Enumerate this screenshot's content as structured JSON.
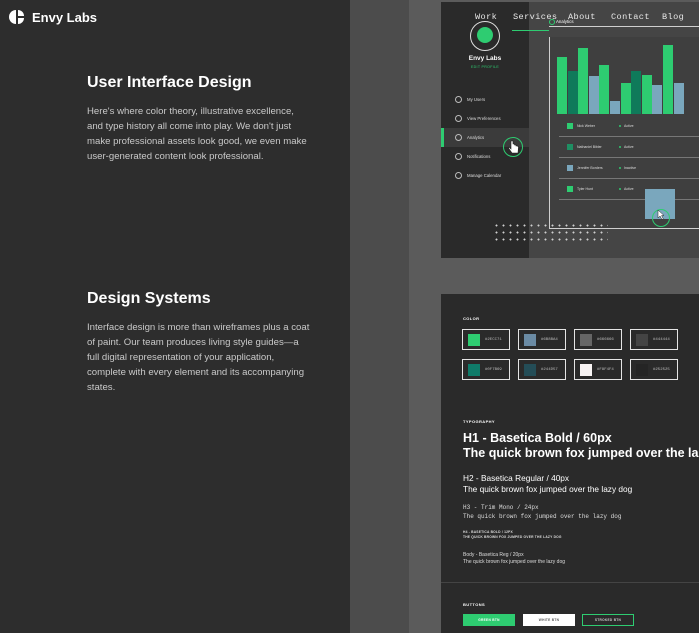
{
  "brand": {
    "name": "Envy Labs",
    "logo_icon": "envy-labs-logo-icon"
  },
  "sections": [
    {
      "title": "User Interface Design",
      "body": "Here's where color theory, illustrative excellence, and type history all come into play. We don't just make professional assets look good, we even make user-generated content look professional."
    },
    {
      "title": "Design Systems",
      "body": "Interface design is more than wireframes plus a coat of paint. Our team produces living style guides—a full digital representation of your application, complete with every element and its accompanying states."
    }
  ],
  "nav": {
    "items": [
      "Work",
      "Services",
      "About",
      "Contact",
      "Blog"
    ],
    "active": "Services"
  },
  "dashboard": {
    "user_name": "Envy Labs",
    "edit_link": "EDIT PROFILE",
    "menu": [
      {
        "label": "My Users",
        "icon": "user-icon"
      },
      {
        "label": "View Preferences",
        "icon": "eye-icon"
      },
      {
        "label": "Analytics",
        "icon": "chart-icon",
        "active": true
      },
      {
        "label": "Notifications",
        "icon": "bell-icon"
      },
      {
        "label": "Manage Calendar",
        "icon": "calendar-icon"
      }
    ],
    "analytics_title": "Analytics",
    "bar_values": [
      0.82,
      0.62,
      0.94,
      0.55,
      0.7,
      0.18,
      0.44,
      0.62,
      0.56,
      0.42,
      0.98,
      0.45
    ],
    "bar_colors": [
      "#0f7a5a",
      "#2ecc71",
      "#7aa7bd"
    ],
    "rows": [
      {
        "name": "Nick Weber",
        "status": "Active",
        "color": "#2ecc71"
      },
      {
        "name": "Nathaniel Bibler",
        "status": "Active",
        "color": "#1f8f63"
      },
      {
        "name": "Jennifer Borders",
        "status": "Inactive",
        "color": "#7aa7bd"
      },
      {
        "name": "Tyler Hunt",
        "status": "Active",
        "color": "#2ecc71"
      }
    ]
  },
  "design_system": {
    "color_label": "COLOR",
    "colors": [
      {
        "hex": "#2ECC71",
        "swatch": "#2ecc71"
      },
      {
        "hex": "#6B8BA4",
        "swatch": "#6b8ba4"
      },
      {
        "hex": "#666666",
        "swatch": "#666666"
      },
      {
        "hex": "#444444",
        "swatch": "#444444"
      },
      {
        "hex": "#0F7B69",
        "swatch": "#0f7b69"
      },
      {
        "hex": "#244D57",
        "swatch": "#244d57"
      },
      {
        "hex": "#F8F4F4",
        "swatch": "#f8f4f4"
      },
      {
        "hex": "#252525",
        "swatch": "#252525"
      }
    ],
    "typography_label": "TYPOGRAPHY",
    "h1_spec": "H1 - Basetica Bold / 60px",
    "h1_sample": "The quick brown fox jumped over the lazy dog",
    "h2_spec": "H2 - Basetica Regular / 40px",
    "h2_sample": "The quick brown fox jumped over the lazy dog",
    "h3_spec": "H3 - Trim Mono / 24px",
    "h3_sample": "The quick brown fox jumped over the lazy dog",
    "h4_spec": "H4 - BASETICA BOLD / 12PX",
    "h4_sample": "THE QUICK BROWN FOX JUMPED OVER THE LAZY DOG",
    "body_spec": "Body - Basetica Reg / 20px",
    "body_sample": "The quick brown fox jumped over the lazy dog",
    "buttons_label": "BUTTONS",
    "buttons": [
      "GREEN BTN",
      "WHITE BTN",
      "STROKED BTN"
    ]
  }
}
